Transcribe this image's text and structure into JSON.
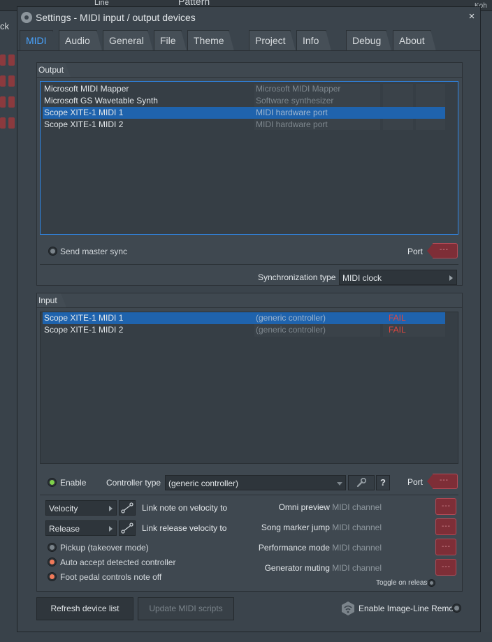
{
  "background": {
    "left_text": "ck",
    "toolbar_line": "Line",
    "toolbar_pattern": "Pattern",
    "right_text": "Koh"
  },
  "dialog": {
    "title": "Settings - MIDI input / output devices",
    "close": "×"
  },
  "tabs": [
    {
      "label": "MIDI",
      "active": true
    },
    {
      "label": "Audio"
    },
    {
      "label": "General"
    },
    {
      "label": "File"
    },
    {
      "label": "Theme"
    },
    {
      "label": "Project"
    },
    {
      "label": "Info"
    },
    {
      "label": "Debug"
    },
    {
      "label": "About"
    }
  ],
  "output": {
    "header": "Output",
    "devices": [
      {
        "name": "Microsoft MIDI Mapper",
        "type": "Microsoft MIDI Mapper",
        "selected": false
      },
      {
        "name": "Microsoft GS Wavetable Synth",
        "type": "Software synthesizer",
        "selected": false
      },
      {
        "name": "Scope XITE-1 MIDI 1",
        "type": "MIDI hardware port",
        "selected": true
      },
      {
        "name": "Scope XITE-1 MIDI 2",
        "type": "MIDI hardware port",
        "selected": false
      }
    ],
    "send_master_sync": "Send master sync",
    "port_label": "Port",
    "port_value": "---",
    "sync_type_label": "Synchronization type",
    "sync_type_value": "MIDI clock"
  },
  "input": {
    "header": "Input",
    "devices": [
      {
        "name": "Scope XITE-1 MIDI 1",
        "type": "(generic controller)",
        "status": "FAIL",
        "selected": true
      },
      {
        "name": "Scope XITE-1 MIDI 2",
        "type": "(generic controller)",
        "status": "FAIL",
        "selected": false
      }
    ],
    "enable": "Enable",
    "controller_type_label": "Controller type",
    "controller_type_value": "(generic controller)",
    "help": "?",
    "port_label": "Port",
    "port_value": "---",
    "velocity_combo": "Velocity",
    "velocity_label": "Link note on velocity to",
    "release_combo": "Release",
    "release_label": "Link release velocity to",
    "pickup": "Pickup (takeover mode)",
    "auto_accept": "Auto accept detected controller",
    "foot_pedal": "Foot pedal controls note off",
    "channels": [
      {
        "label": "Omni preview",
        "suffix": "MIDI channel",
        "value": "---"
      },
      {
        "label": "Song marker jump",
        "suffix": "MIDI channel",
        "value": "---"
      },
      {
        "label": "Performance mode",
        "suffix": "MIDI channel",
        "value": "---"
      },
      {
        "label": "Generator muting",
        "suffix": "MIDI channel",
        "value": "---"
      }
    ],
    "toggle_on_release": "Toggle on release"
  },
  "footer": {
    "refresh": "Refresh device list",
    "update_scripts": "Update MIDI scripts",
    "remote": "Enable Image-Line Remote"
  },
  "colors": {
    "accent": "#49a4ff",
    "selection": "#1f63ad",
    "fail": "#e0473f",
    "port": "#7e2e37",
    "enable_led": "#7fd24a",
    "option_led": "#f07a5a"
  }
}
